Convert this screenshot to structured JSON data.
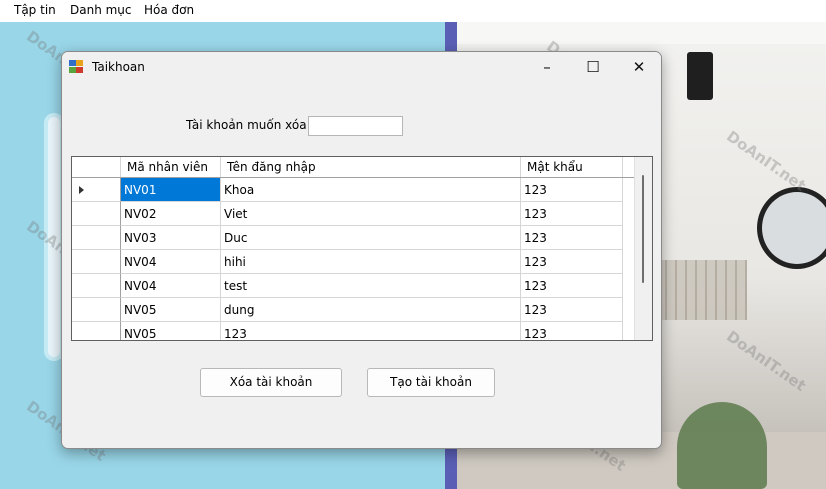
{
  "menu": [
    "Tập tin",
    "Danh mục",
    "Hóa đơn"
  ],
  "watermark": "DoAnIT.net",
  "window": {
    "title": "Taikhoan",
    "minimize_glyph": "–",
    "maximize_glyph": "☐",
    "close_glyph": "✕"
  },
  "form": {
    "delete_label": "Tài khoản muốn xóa:",
    "delete_value": ""
  },
  "grid": {
    "columns": [
      "Mã nhân viên",
      "Tên đăng nhập",
      "Mật khẩu"
    ],
    "rows": [
      {
        "id": "NV01",
        "username": "Khoa",
        "password": "123"
      },
      {
        "id": "NV02",
        "username": "Viet",
        "password": "123"
      },
      {
        "id": "NV03",
        "username": "Duc",
        "password": "123"
      },
      {
        "id": "NV04",
        "username": "hihi",
        "password": "123"
      },
      {
        "id": "NV04",
        "username": "test",
        "password": "123"
      },
      {
        "id": "NV05",
        "username": "dung",
        "password": "123"
      },
      {
        "id": "NV05",
        "username": "123",
        "password": "123"
      }
    ],
    "selected_row": 0
  },
  "buttons": {
    "delete": "Xóa tài khoản",
    "create": "Tạo tài khoản"
  },
  "colors": {
    "selection": "#0078d7",
    "window_bg": "#f0f0f0",
    "parent_left": "#98d6e8",
    "parent_stripe": "#5a5fb5"
  }
}
